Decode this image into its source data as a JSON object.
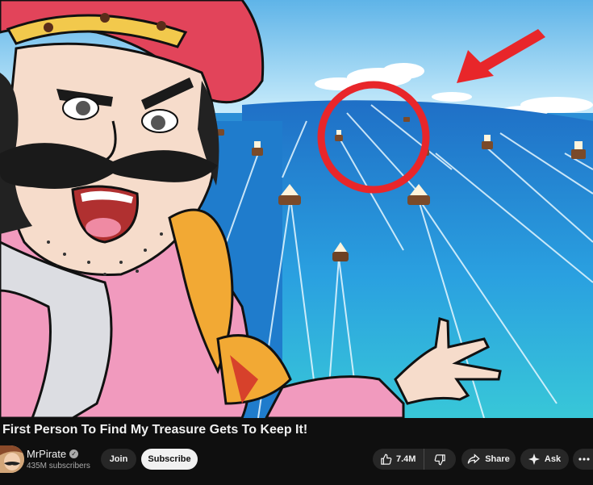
{
  "video": {
    "title": "First Person To Find My Treasure Gets To Keep It!"
  },
  "channel": {
    "name": "MrPirate",
    "subscribers": "435M subscribers",
    "verified_icon": "verified-check-icon"
  },
  "actions": {
    "join_label": "Join",
    "subscribe_label": "Subscribe",
    "like_count": "7.4M",
    "share_label": "Share",
    "ask_label": "Ask",
    "more_icon": "more-horizontal-icon"
  },
  "colors": {
    "background": "#0f0f0f",
    "pill": "#272727",
    "subscribe_bg": "#f1f1f1",
    "accent_red": "#e8262a"
  }
}
